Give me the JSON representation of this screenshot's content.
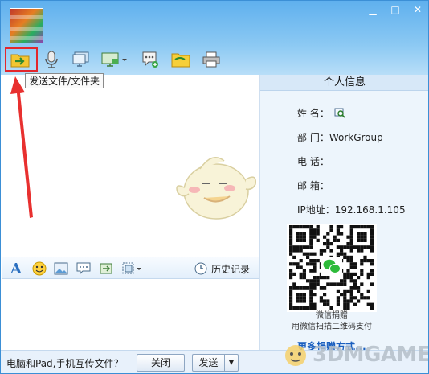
{
  "window": {
    "minimize_glyph": "▁",
    "maximize_glyph": "□",
    "close_glyph": "✕"
  },
  "toolbar": {
    "items": [
      {
        "name": "send-file-folder-button",
        "icon": "folder-send-icon"
      },
      {
        "name": "voice-button",
        "icon": "microphone-icon"
      },
      {
        "name": "remote-screen-button",
        "icon": "monitor-icon"
      },
      {
        "name": "screen-share-button",
        "icon": "screen-dropdown-icon"
      },
      {
        "name": "message-button",
        "icon": "chat-bubble-icon"
      },
      {
        "name": "shared-folder-button",
        "icon": "folder-icon"
      },
      {
        "name": "print-button",
        "icon": "printer-icon"
      }
    ],
    "tooltip": "发送文件/文件夹"
  },
  "format_bar": {
    "history_label": "历史记录",
    "icons": [
      "font-icon",
      "emoji-icon",
      "image-icon",
      "quick-reply-icon",
      "screenshot-icon",
      "shake-icon"
    ]
  },
  "info_panel": {
    "title": "个人信息",
    "name_label": "姓 名：",
    "dept_label": "部 门：",
    "dept_value": "WorkGroup",
    "phone_label": "电 话：",
    "email_label": "邮 箱：",
    "ip_label": "IP地址：",
    "ip_value": "192.168.1.105",
    "qr_caption1": "微信捐赠",
    "qr_caption2": "用微信扫描二维码支付",
    "donate_link": "更多捐赠方式..."
  },
  "bottom_bar": {
    "hint": "电脑和Pad,手机互传文件？",
    "close_label": "关闭",
    "send_label": "发送",
    "send_dropdown": "▼"
  },
  "watermark": {
    "text": "3DMGAME"
  },
  "colors": {
    "accent": "#3b8fd6",
    "highlight_red": "#e3262c",
    "panel_bg": "#edf5fc"
  }
}
